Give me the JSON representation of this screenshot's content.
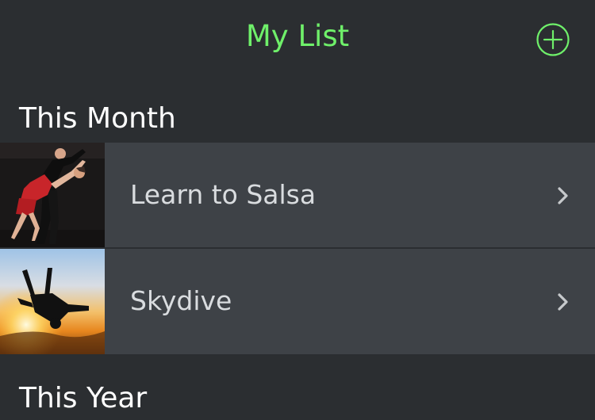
{
  "nav": {
    "title": "My List",
    "add_icon": "plus-circle-icon"
  },
  "sections": [
    {
      "header": "This Month",
      "items": [
        {
          "label": "Learn to Salsa",
          "thumbnail": "salsa-dancers-photo",
          "chevron_icon": "chevron-right-icon"
        },
        {
          "label": "Skydive",
          "thumbnail": "skydiver-sunset-photo",
          "chevron_icon": "chevron-right-icon"
        }
      ]
    },
    {
      "header": "This Year",
      "items": []
    }
  ],
  "colors": {
    "accent": "#6ff06a",
    "background": "#2b2e31",
    "row_background": "#3e4247",
    "row_text": "#d9dcdf",
    "header_text": "#ffffff",
    "chevron": "#c6c9cc"
  }
}
